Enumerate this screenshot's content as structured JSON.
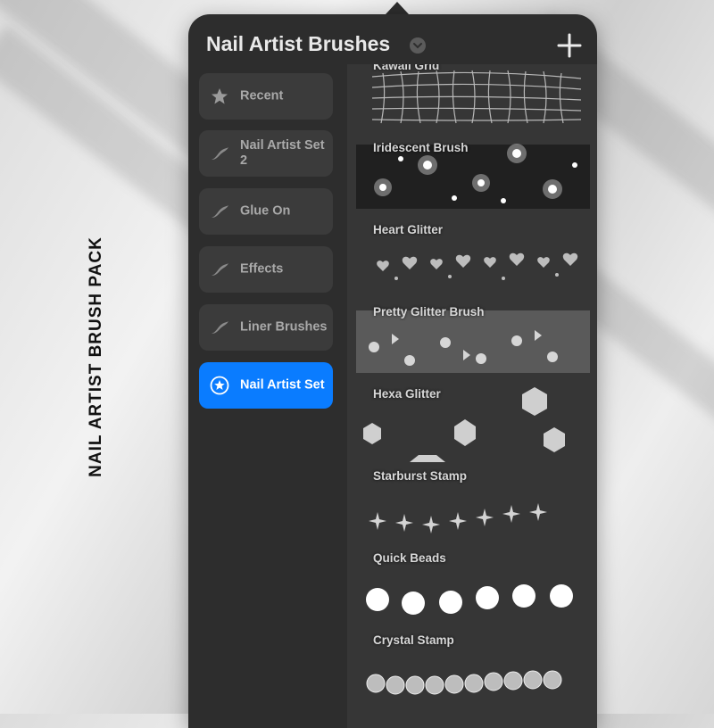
{
  "side_caption": "NAIL ARTIST  BRUSH PACK",
  "header": {
    "title": "Nail Artist Brushes"
  },
  "sidebar": {
    "items": [
      {
        "label": "Recent",
        "icon": "star-icon",
        "active": false
      },
      {
        "label": "Nail Artist Set 2",
        "icon": "brush-stroke-icon",
        "active": false
      },
      {
        "label": "Glue On",
        "icon": "brush-stroke-icon",
        "active": false
      },
      {
        "label": "Effects",
        "icon": "brush-stroke-icon",
        "active": false
      },
      {
        "label": "Liner Brushes",
        "icon": "brush-stroke-icon",
        "active": false
      },
      {
        "label": "Nail Artist Set",
        "icon": "star-circle-icon",
        "active": true
      }
    ]
  },
  "brushes": {
    "items": [
      {
        "name": "Kawaii Grid"
      },
      {
        "name": "Iridescent Brush"
      },
      {
        "name": "Heart Glitter"
      },
      {
        "name": "Pretty Glitter Brush"
      },
      {
        "name": "Hexa Glitter"
      },
      {
        "name": "Starburst Stamp"
      },
      {
        "name": "Quick Beads"
      },
      {
        "name": "Crystal Stamp"
      }
    ]
  },
  "colors": {
    "accent": "#0a7cff",
    "panel": "#2d2d2d",
    "tile": "#3b3b3b"
  }
}
